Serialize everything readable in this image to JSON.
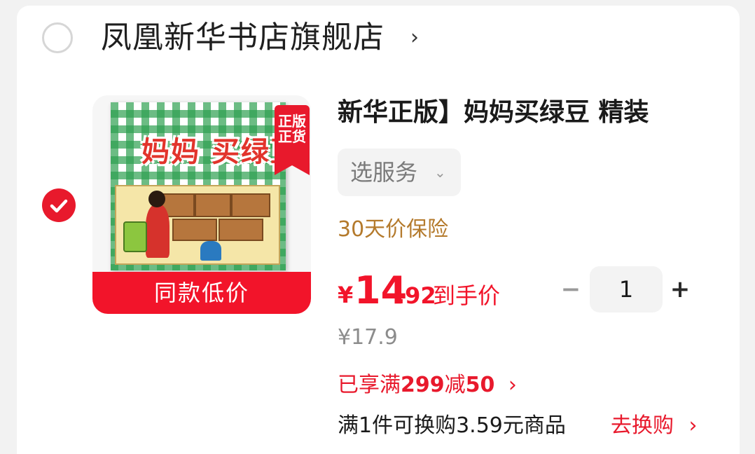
{
  "shop": {
    "name": "凤凰新华书店旗舰店",
    "chevron": "›"
  },
  "product": {
    "title": "新华正版】妈妈买绿豆 精装",
    "cover_title": "妈妈 买绿豆!",
    "ribbon": "正版正货",
    "badge": "同款低价",
    "service_label": "选服务",
    "service_chevron": "⌄",
    "insurance": "30天价保险",
    "price_currency": "¥",
    "price_integer": "14",
    "price_decimal": ".92",
    "price_suffix": "到手价",
    "original_price": "¥17.9",
    "promo_prefix": "已享满",
    "promo_threshold": "299",
    "promo_mid": "减",
    "promo_amount": "50",
    "promo_chevron": "›",
    "exchange_text": "满1件可换购3.59元商品",
    "exchange_link": "去换购",
    "exchange_chevron": "›"
  },
  "stepper": {
    "minus": "−",
    "quantity": "1",
    "plus": "+"
  },
  "colors": {
    "accent": "#e8192c",
    "price": "#f2142a",
    "insurance": "#b47a2c"
  }
}
